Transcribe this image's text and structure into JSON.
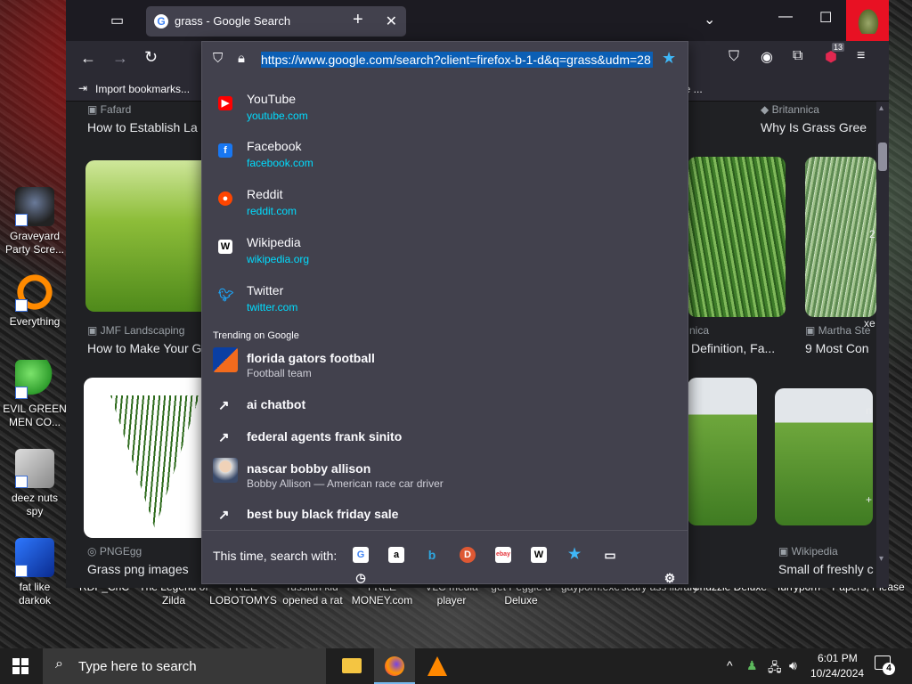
{
  "desktop": {
    "icons": [
      {
        "label": "Graveyard Party Scre..."
      },
      {
        "label": "Everything"
      },
      {
        "label": "EVIL GREEN MEN CO..."
      },
      {
        "label": "deez nuts spy"
      },
      {
        "label": "fat like darkok"
      }
    ],
    "bottom_labels": [
      "RDP_ChC",
      "The Legend of Zilda",
      "FREE LOBOTOMYS",
      "russian kid opened a rat",
      "FREE MONEY.com",
      "VLC media player",
      "get Peggle d Deluxe",
      "gayporn.exe",
      "scary ass library",
      "Chuzzle Deluxe",
      "furryporn",
      "Papers, Please"
    ]
  },
  "browser": {
    "tab_title": "grass - Google Search",
    "new_tab": "+",
    "url": "https://www.google.com/search?client=firefox-b-1-d&q=grass&udm=28",
    "extension_badge": "13",
    "bookmarks": {
      "import": "Import bookmarks...",
      "right": "pe ..."
    },
    "results": {
      "row1": [
        {
          "source": "Fafard",
          "title": "How to Establish La"
        },
        {
          "source": "Britannica",
          "title": "Why Is Grass Gree"
        }
      ],
      "row2": [
        {
          "source": "JMF Landscaping",
          "title": "How to Make Your G"
        },
        {
          "source": "nica",
          "title": "Definition, Fa..."
        },
        {
          "source": "Martha Ste",
          "title": "9 Most Con"
        }
      ],
      "row3": [
        {
          "source": "PNGEgg",
          "title": "Grass png images"
        },
        {
          "source": "Wikipedia",
          "title": "Small of freshly c"
        }
      ],
      "edge_chars": [
        "2",
        "xe",
        "n",
        "+"
      ]
    }
  },
  "dropdown": {
    "suggestions": [
      {
        "name": "YouTube",
        "url": "youtube.com"
      },
      {
        "name": "Facebook",
        "url": "facebook.com"
      },
      {
        "name": "Reddit",
        "url": "reddit.com"
      },
      {
        "name": "Wikipedia",
        "url": "wikipedia.org"
      },
      {
        "name": "Twitter",
        "url": "twitter.com"
      }
    ],
    "trending_header": "Trending on Google",
    "trending": [
      {
        "query": "florida gators football",
        "sub": "Football team"
      },
      {
        "query": "ai chatbot",
        "sub": ""
      },
      {
        "query": "federal agents frank sinito",
        "sub": ""
      },
      {
        "query": "nascar bobby allison",
        "sub": "Bobby Allison — American race car driver"
      },
      {
        "query": "best buy black friday sale",
        "sub": ""
      }
    ],
    "search_with_label": "This time, search with:"
  },
  "taskbar": {
    "search_placeholder": "Type here to search",
    "time": "6:01 PM",
    "date": "10/24/2024",
    "notification_count": "4"
  },
  "colors": {
    "accent": "#00ddff",
    "highlight": "#0b5fb5",
    "star": "#3fb7f7"
  }
}
